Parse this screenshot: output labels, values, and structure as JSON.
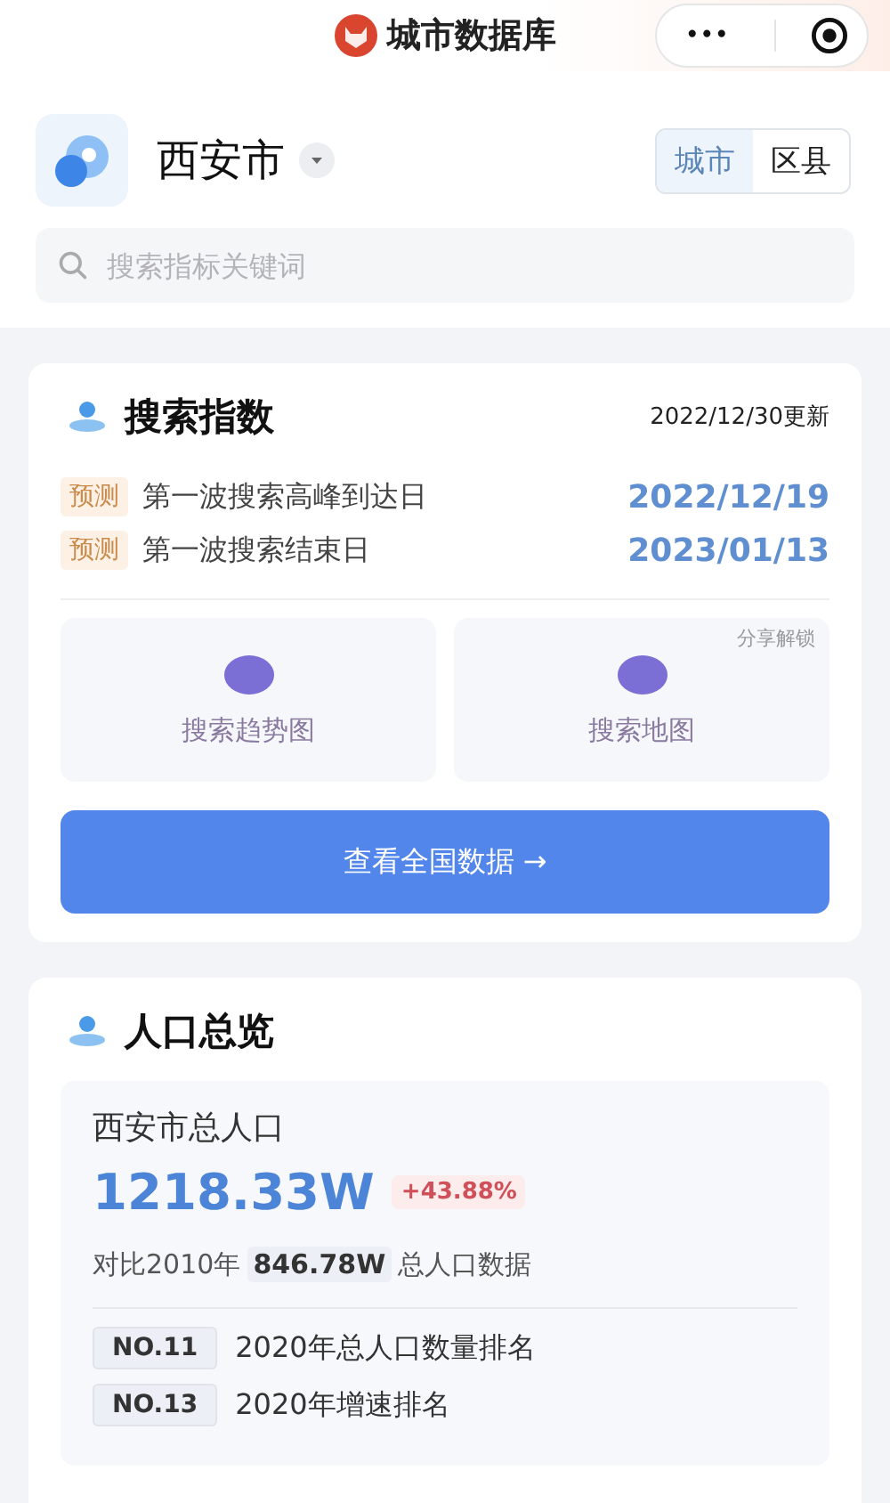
{
  "nav": {
    "title": "城市数据库",
    "more": "•••"
  },
  "header": {
    "city": "西安市",
    "scope_tabs": [
      {
        "label": "城市",
        "selected": true
      },
      {
        "label": "区县",
        "selected": false
      }
    ],
    "search": {
      "placeholder": "搜索指标关键词"
    }
  },
  "search_index": {
    "title": "搜索指数",
    "updated": "2022/12/30更新",
    "rows": [
      {
        "tag": "预测",
        "label": "第一波搜索高峰到达日",
        "date": "2022/12/19"
      },
      {
        "tag": "预测",
        "label": "第一波搜索结束日",
        "date": "2023/01/13"
      }
    ],
    "tiles": [
      {
        "label": "搜索趋势图"
      },
      {
        "label": "搜索地图",
        "badge": "分享解锁"
      }
    ],
    "button": "查看全国数据 →"
  },
  "population": {
    "title": "人口总览",
    "stat_label": "西安市总人口",
    "value": "1218.33W",
    "change": "+43.88%",
    "compare": {
      "prefix": "对比2010年",
      "value": "846.78W",
      "suffix": "总人口数据"
    },
    "ranks": [
      {
        "rank": "NO.11",
        "label": "2020年总人口数量排名"
      },
      {
        "rank": "NO.13",
        "label": "2020年增速排名"
      }
    ]
  }
}
